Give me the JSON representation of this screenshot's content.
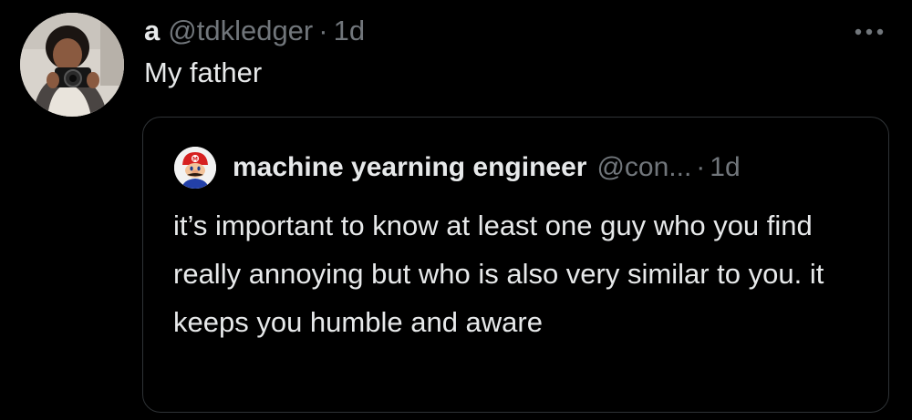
{
  "tweet": {
    "display_name": "a",
    "handle": "@tdkledger",
    "separator": "·",
    "time": "1d",
    "text": "My father",
    "more_icon": "more-horizontal-icon"
  },
  "quote": {
    "display_name": "machine yearning engineer",
    "handle": "@con...",
    "separator": "·",
    "time": "1d",
    "text": "it’s important to know at least one guy who you find really annoying but who is also very similar to you. it keeps you humble and aware"
  },
  "colors": {
    "background": "#000000",
    "primary_text": "#e7e9ea",
    "secondary_text": "#71767b",
    "border": "#2f3336"
  }
}
